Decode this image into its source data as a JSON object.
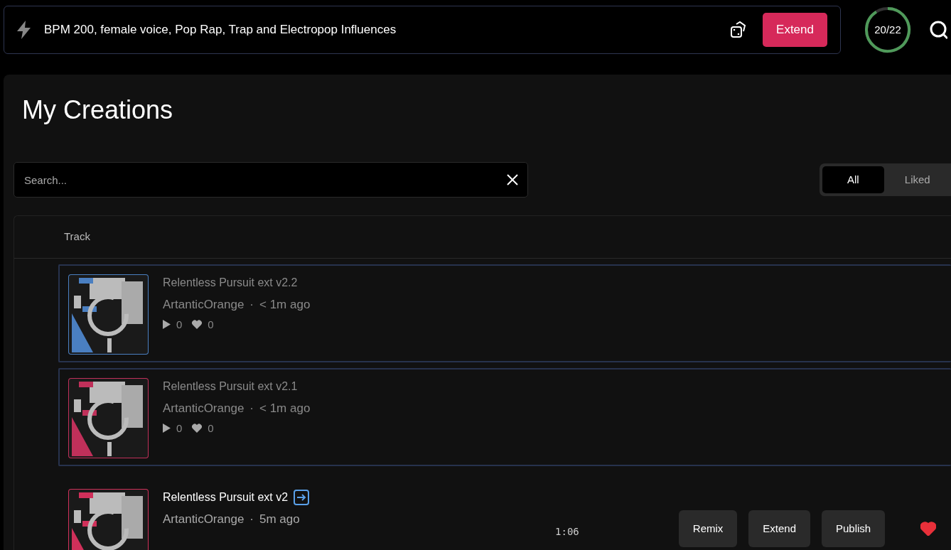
{
  "prompt_bar": {
    "value": "BPM 200, female voice, Pop Rap, Trap and Electropop Influences",
    "button": "Extend"
  },
  "credits": {
    "text": "20/22",
    "level": 0.91
  },
  "title": "My Creations",
  "search": {
    "placeholder": "Search..."
  },
  "filter_tabs": [
    {
      "label": "All",
      "selected": true
    },
    {
      "label": "Liked",
      "selected": false
    }
  ],
  "table": {
    "columns": [
      "Track"
    ],
    "rows": [
      {
        "kind": "pending",
        "title": "Relentless Pursuit ext v2.2",
        "author": "ArtanticOrange",
        "separator": "·",
        "time": "< 1m ago",
        "plays": "0",
        "likes": "0",
        "color": "#4a7fc1"
      },
      {
        "kind": "pending",
        "title": "Relentless Pursuit ext v2.1",
        "author": "ArtanticOrange",
        "separator": "·",
        "time": "< 1m ago",
        "plays": "0",
        "likes": "0",
        "color": "#c0305a"
      },
      {
        "kind": "ready",
        "title": "Relentless Pursuit ext v2",
        "author": "ArtanticOrange",
        "separator": "·",
        "time": "5m ago",
        "duration": "1:06",
        "buttons": [
          "Remix",
          "Extend",
          "Publish"
        ],
        "liked": true,
        "color": "#d0305a"
      }
    ]
  }
}
